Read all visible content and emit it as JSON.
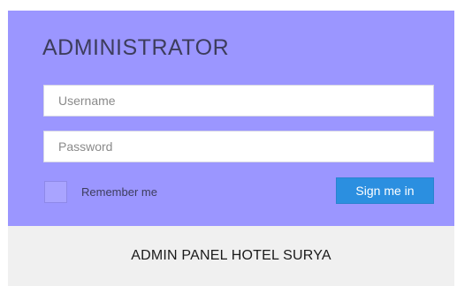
{
  "panel": {
    "title": "ADMINISTRATOR",
    "background_color": "#9b96ff",
    "username": {
      "placeholder": "Username",
      "value": ""
    },
    "password": {
      "placeholder": "Password",
      "value": ""
    },
    "remember": {
      "label": "Remember me",
      "checked": false
    },
    "signin": {
      "label": "Sign me in",
      "color": "#2b8fe0"
    }
  },
  "footer": {
    "text": "ADMIN PANEL HOTEL SURYA"
  }
}
